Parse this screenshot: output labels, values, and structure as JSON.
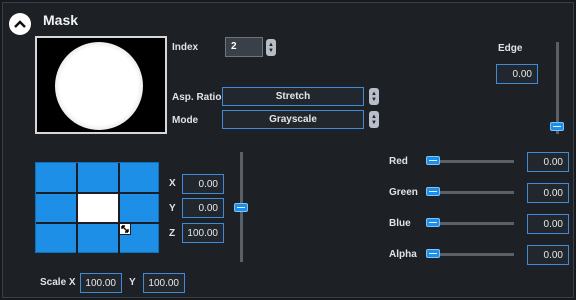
{
  "panel": {
    "title": "Mask",
    "collapse_icon": "chevron-up-icon"
  },
  "index": {
    "label": "Index",
    "value": "2"
  },
  "aspect": {
    "label": "Asp. Ratio",
    "value": "Stretch"
  },
  "mode": {
    "label": "Mode",
    "value": "Grayscale"
  },
  "edge": {
    "label": "Edge",
    "value": "0.00"
  },
  "position": {
    "x": {
      "label": "X",
      "value": "0.00"
    },
    "y": {
      "label": "Y",
      "value": "0.00"
    },
    "z": {
      "label": "Z",
      "value": "100.00"
    }
  },
  "scale": {
    "label": "Scale X",
    "x_value": "100.00",
    "y_label": "Y",
    "y_value": "100.00"
  },
  "colors": {
    "red": {
      "label": "Red",
      "value": "0.00"
    },
    "green": {
      "label": "Green",
      "value": "0.00"
    },
    "blue": {
      "label": "Blue",
      "value": "0.00"
    },
    "alpha": {
      "label": "Alpha",
      "value": "0.00"
    }
  },
  "theme": {
    "accent": "#1e8fe6",
    "background": "#1d2025",
    "border": "#3f8bd8"
  }
}
